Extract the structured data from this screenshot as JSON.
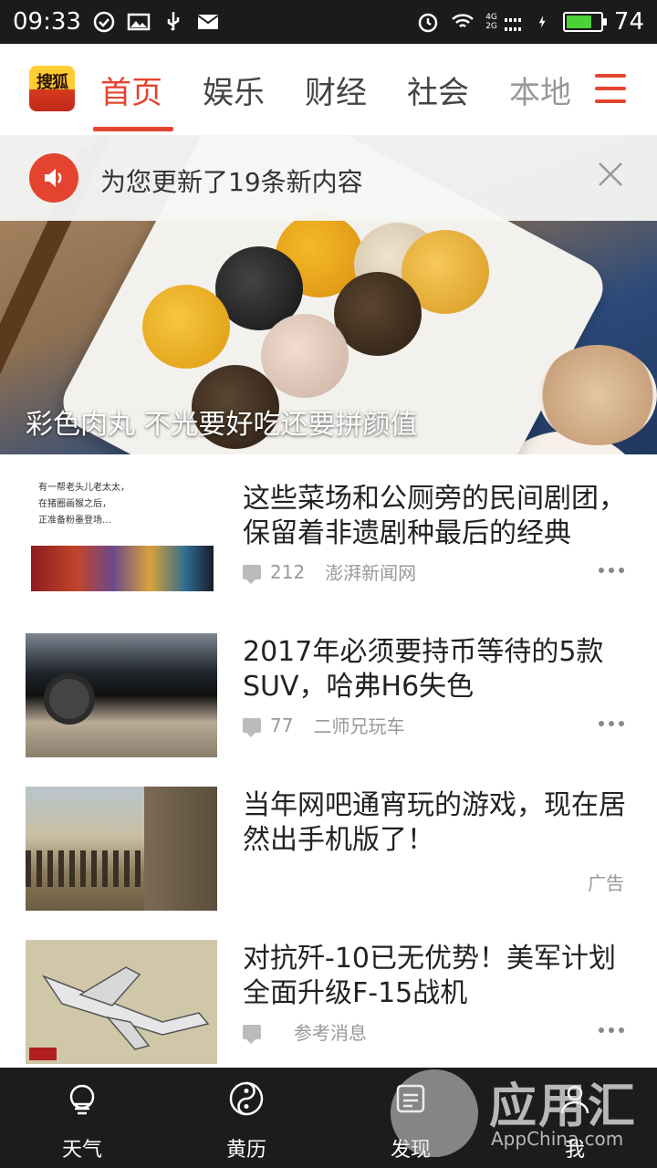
{
  "status_bar": {
    "time": "09:33",
    "network_top": "4G",
    "network_bottom": "2G",
    "battery": "74",
    "battery_level": 0.74
  },
  "app": {
    "logo_text": "搜狐"
  },
  "tabs": [
    {
      "label": "首页",
      "active": true
    },
    {
      "label": "娱乐",
      "active": false
    },
    {
      "label": "财经",
      "active": false
    },
    {
      "label": "社会",
      "active": false
    },
    {
      "label": "本地",
      "active": false
    }
  ],
  "notice": {
    "text": "为您更新了19条新内容"
  },
  "hero": {
    "caption": "彩色肉丸 不光要好吃还要拼颜值"
  },
  "news": [
    {
      "title": "这些菜场和公厕旁的民间剧团，保留着非遗剧种最后的经典",
      "comments": "212",
      "source": "澎湃新闻网",
      "ad": ""
    },
    {
      "title": "2017年必须要持币等待的5款SUV，哈弗H6失色",
      "comments": "77",
      "source": "二师兄玩车",
      "ad": ""
    },
    {
      "title": "当年网吧通宵玩的游戏，现在居然出手机版了！",
      "comments": "",
      "source": "",
      "ad": "广告"
    },
    {
      "title": "对抗歼-10已无优势！美军计划全面升级F-15战机",
      "comments": "",
      "source": "参考消息",
      "ad": ""
    }
  ],
  "thumb1_text": [
    "有一帮老头儿老太太，",
    "在猪圈画猴之后，",
    "正准备粉墨登场…"
  ],
  "bottom_nav": [
    {
      "label": "天气"
    },
    {
      "label": "黄历"
    },
    {
      "label": "发现"
    },
    {
      "label": "我"
    }
  ],
  "watermark": {
    "text": "应用汇",
    "sub": "AppChina.com"
  }
}
